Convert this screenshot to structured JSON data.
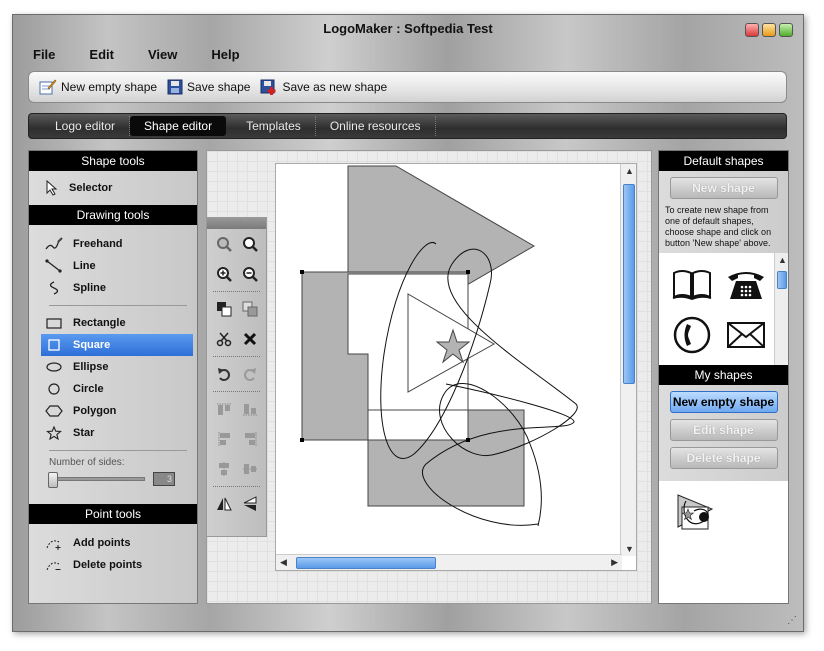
{
  "window": {
    "title": "LogoMaker : Softpedia Test"
  },
  "menu": [
    "File",
    "Edit",
    "View",
    "Help"
  ],
  "toolbar": {
    "new_empty_shape": "New empty shape",
    "save_shape": "Save shape",
    "save_as_new_shape": "Save as new shape"
  },
  "tabs": [
    "Logo editor",
    "Shape editor",
    "Templates",
    "Online resources"
  ],
  "active_tab": "Shape editor",
  "left": {
    "shape_tools_title": "Shape tools",
    "selector": "Selector",
    "drawing_tools_title": "Drawing tools",
    "freehand": "Freehand",
    "line": "Line",
    "spline": "Spline",
    "rectangle": "Rectangle",
    "square": "Square",
    "ellipse": "Ellipse",
    "circle": "Circle",
    "polygon": "Polygon",
    "star": "Star",
    "number_of_sides_label": "Number of sides:",
    "number_of_sides_value": "3",
    "point_tools_title": "Point tools",
    "add_points": "Add points",
    "delete_points": "Delete points"
  },
  "right": {
    "default_shapes_title": "Default shapes",
    "new_shape_button": "New shape",
    "help_text": "To create new shape from one of default shapes, choose shape and click on button 'New shape' above.",
    "my_shapes_title": "My shapes",
    "new_empty_shape_button": "New empty shape",
    "edit_shape_button": "Edit shape",
    "delete_shape_button": "Delete shape"
  },
  "colors": {
    "accent": "#2e6fd8",
    "shape_fill": "#b3b3b3",
    "panel_header": "#000000"
  }
}
